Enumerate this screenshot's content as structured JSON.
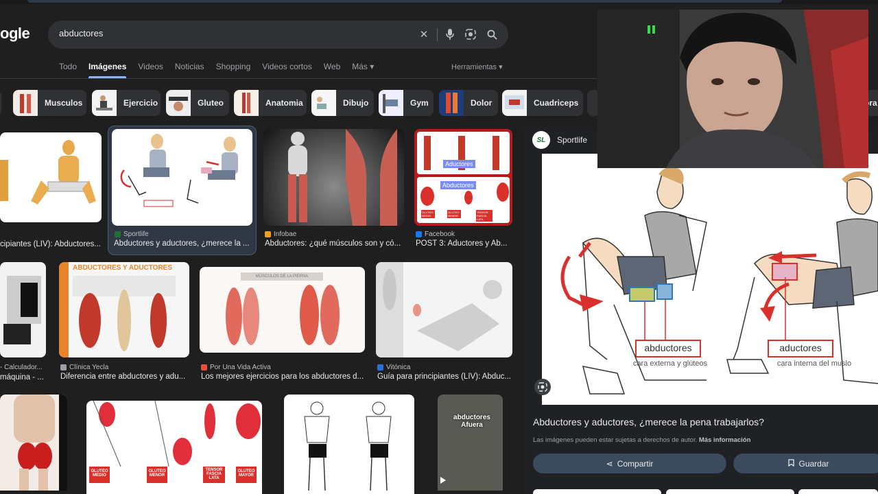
{
  "search": {
    "logo": "ogle",
    "query": "abductores"
  },
  "tabs": [
    "Todo",
    "Imágenes",
    "Videos",
    "Noticias",
    "Shopping",
    "Videos cortos",
    "Web",
    "Más ▾"
  ],
  "tools_label": "Herramientas ▾",
  "chips": [
    "Musculos",
    "Ejercicio",
    "Gluteo",
    "Anatomia",
    "Dibujo",
    "Gym",
    "Dolor",
    "Cuadriceps",
    "ora"
  ],
  "results": {
    "r1c1": {
      "source": "",
      "title": "cipiantes (LIV): Abductores..."
    },
    "r1c2": {
      "source": "Sportlife",
      "title": "Abductores y aductores, ¿merece la ..."
    },
    "r1c3": {
      "source": "Infobae",
      "title": "Abductores: ¿qué músculos son y có..."
    },
    "r1c4": {
      "source": "Facebook",
      "title": "POST 3: Aductores y Ab..."
    },
    "r2c1": {
      "source": "- Calculador...",
      "title": "máquina - ..."
    },
    "r2c2": {
      "source": "Clínica Yecla",
      "title": "Diferencia entre abductores y adu..."
    },
    "r2c3": {
      "source": "Por Una Vida Activa",
      "title": "Los mejores ejercicios para los abductores d..."
    },
    "r2c4": {
      "source": "Vitónica",
      "title": "Guía para principiantes (LIV): Abduc..."
    }
  },
  "image_text": {
    "fb_label1": "Aductores",
    "fb_label2": "Abductores",
    "fb_tags": [
      "GLUTEO MEDIO",
      "GLUTEO MENOR",
      "TENSOR FASCIA LATA"
    ],
    "yecla_heading": "ABDUCTORES Y ADUCTORES",
    "vida_heading": "MÚSCULOS DE LA PIERNA",
    "muscle_tags": [
      "GLUTEO MEDIO",
      "GLUTEO MENOR",
      "TENSOR FASCIA LATA",
      "GLUTEO MAYOR"
    ],
    "video_caption": "abductores\nAfuera",
    "preview_label1": "abductores",
    "preview_sub1": "cara externa y glúteos",
    "preview_label2": "aductores",
    "preview_sub2": "cara interna del muslo"
  },
  "panel": {
    "source": "Sportlife",
    "logo_text": "SL",
    "title": "Abductores y aductores, ¿merece la pena trabajarlos?",
    "note": "Las imágenes pueden estar sujetas a derechos de autor.",
    "note_link": "Más información",
    "share": "Compartir",
    "save": "Guardar"
  },
  "colors": {
    "background": "#1f1f1f",
    "accent": "#8ab4f8",
    "muscle_red": "#d9302c"
  }
}
